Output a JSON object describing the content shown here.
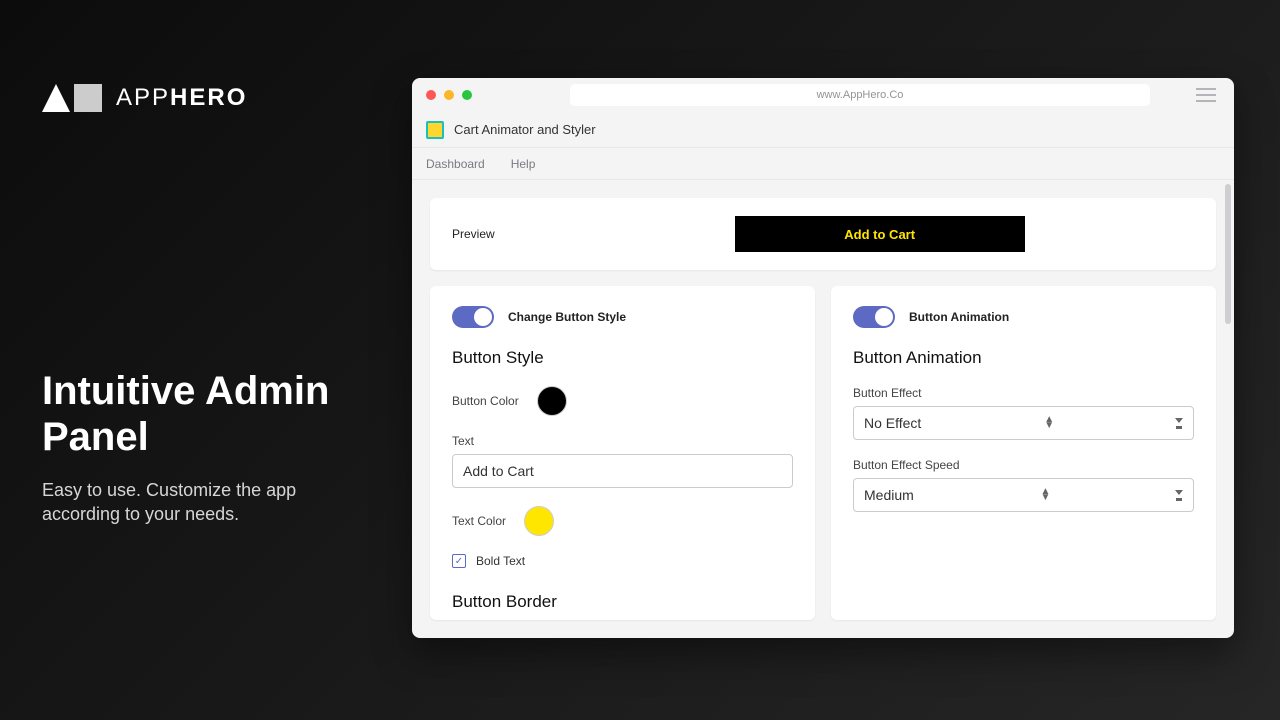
{
  "brand": {
    "name_light": "APP",
    "name_bold": "HERO"
  },
  "headline": "Intuitive Admin Panel",
  "subhead": "Easy to use. Customize the app according to your needs.",
  "browser": {
    "url": "www.AppHero.Co"
  },
  "app": {
    "title": "Cart Animator and Styler"
  },
  "tabs": {
    "dashboard": "Dashboard",
    "help": "Help"
  },
  "preview": {
    "label": "Preview",
    "button_text": "Add to Cart",
    "button_bg": "#000000",
    "button_fg": "#ffe600"
  },
  "style_panel": {
    "toggle_label": "Change Button Style",
    "title": "Button Style",
    "button_color_label": "Button Color",
    "button_color": "#000000",
    "text_label": "Text",
    "text_value": "Add to Cart",
    "text_color_label": "Text Color",
    "text_color": "#ffe600",
    "bold_label": "Bold Text",
    "bold_checked": true,
    "border_title": "Button Border"
  },
  "anim_panel": {
    "toggle_label": "Button Animation",
    "title": "Button Animation",
    "effect_label": "Button Effect",
    "effect_value": "No Effect",
    "speed_label": "Button Effect Speed",
    "speed_value": "Medium"
  }
}
